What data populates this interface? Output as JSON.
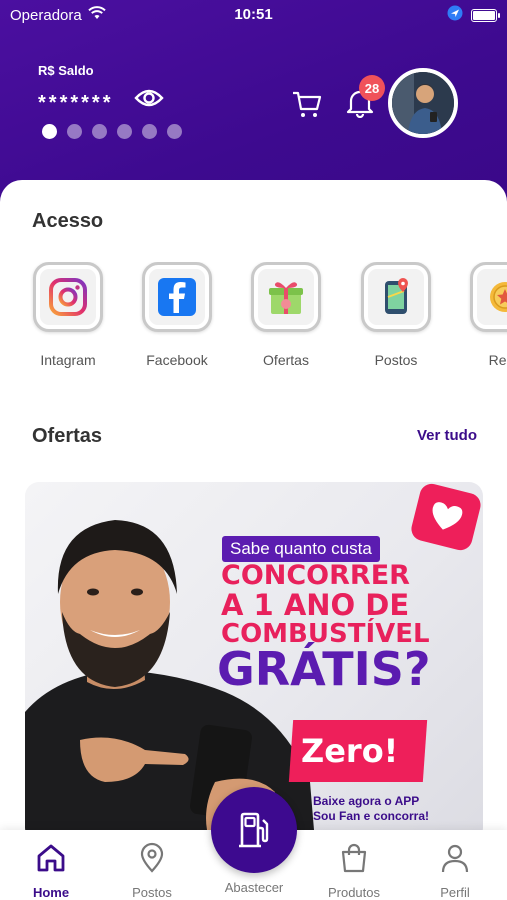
{
  "status_bar": {
    "carrier": "Operadora",
    "time": "10:51",
    "battery_level": 1.0
  },
  "header": {
    "balance_label": "R$ Saldo",
    "balance_masked": "*******",
    "carousel_dots": 6,
    "carousel_active_index": 0,
    "notification_count": "28",
    "accent_color": "#3d0a8f"
  },
  "access": {
    "title": "Acesso",
    "items": [
      {
        "label": "Intagram",
        "icon": "instagram-icon"
      },
      {
        "label": "Facebook",
        "icon": "facebook-icon"
      },
      {
        "label": "Ofertas",
        "icon": "gift-icon"
      },
      {
        "label": "Postos",
        "icon": "map-phone-icon"
      },
      {
        "label": "Resg",
        "icon": "coin-icon"
      }
    ]
  },
  "offers": {
    "title": "Ofertas",
    "see_all": "Ver tudo",
    "banner": {
      "pill": "Sabe quanto custa",
      "line1": "CONCORRER",
      "line2": "A 1 ANO DE",
      "line3": "COMBUSTÍVEL",
      "line4": "GRÁTIS?",
      "zero": "Zero!",
      "cta1": "Baixe agora o APP",
      "cta2": "Sou Fan e concorra!"
    }
  },
  "bottom_nav": {
    "items": [
      {
        "label": "Home",
        "icon": "home-icon",
        "active": true
      },
      {
        "label": "Postos",
        "icon": "location-pin-icon",
        "active": false
      },
      {
        "label": "Produtos",
        "icon": "shopping-bag-icon",
        "active": false
      },
      {
        "label": "Perfil",
        "icon": "user-icon",
        "active": false
      }
    ],
    "center_action": {
      "label": "Abastecer",
      "icon": "fuel-pump-icon"
    }
  }
}
